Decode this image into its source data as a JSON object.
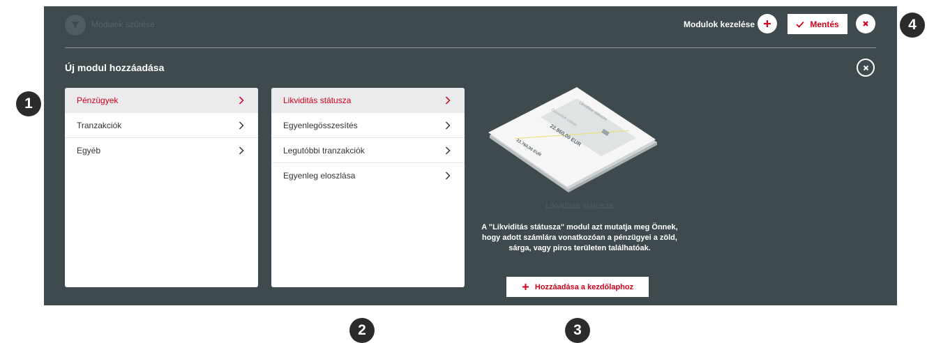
{
  "callouts": [
    "1",
    "2",
    "3",
    "4"
  ],
  "topbar": {
    "filter_label": "Modulok szűrése",
    "manage_label": "Modulok kezelése",
    "save_label": "Mentés"
  },
  "panel": {
    "title": "Új modul hozzáadása"
  },
  "categories": {
    "items": [
      {
        "label": "Pénzügyek",
        "active": true
      },
      {
        "label": "Tranzakciók",
        "active": false
      },
      {
        "label": "Egyéb",
        "active": false
      }
    ]
  },
  "modules": {
    "items": [
      {
        "label": "Likviditás státusza",
        "active": true
      },
      {
        "label": "Egyenlegösszesítés",
        "active": false
      },
      {
        "label": "Legutóbbi tranzakciók",
        "active": false
      },
      {
        "label": "Egyenleg eloszlása",
        "active": false
      }
    ]
  },
  "preview": {
    "card_title": "Likviditási státusza",
    "card_field": "Összesített számla",
    "amount1": "22.860,00 EUR",
    "amount2": "22.760,00 EUR",
    "module_title": "Likviditás státusza",
    "description": "A \"Likviditás státusza\" modul azt mutatja meg Önnek, hogy adott számlára vonatkozóan a pénzügyei a zöld, sárga, vagy piros területen találhatóak.",
    "add_label": "Hozzáadása a kezdőlaphoz"
  },
  "colors": {
    "accent": "#d0021b",
    "panel_bg": "#3f4a4e",
    "badge_bg": "#2b2b2b"
  },
  "icons": [
    "filter-icon",
    "plus-icon",
    "check-icon",
    "close-icon",
    "chevron-right-icon"
  ]
}
